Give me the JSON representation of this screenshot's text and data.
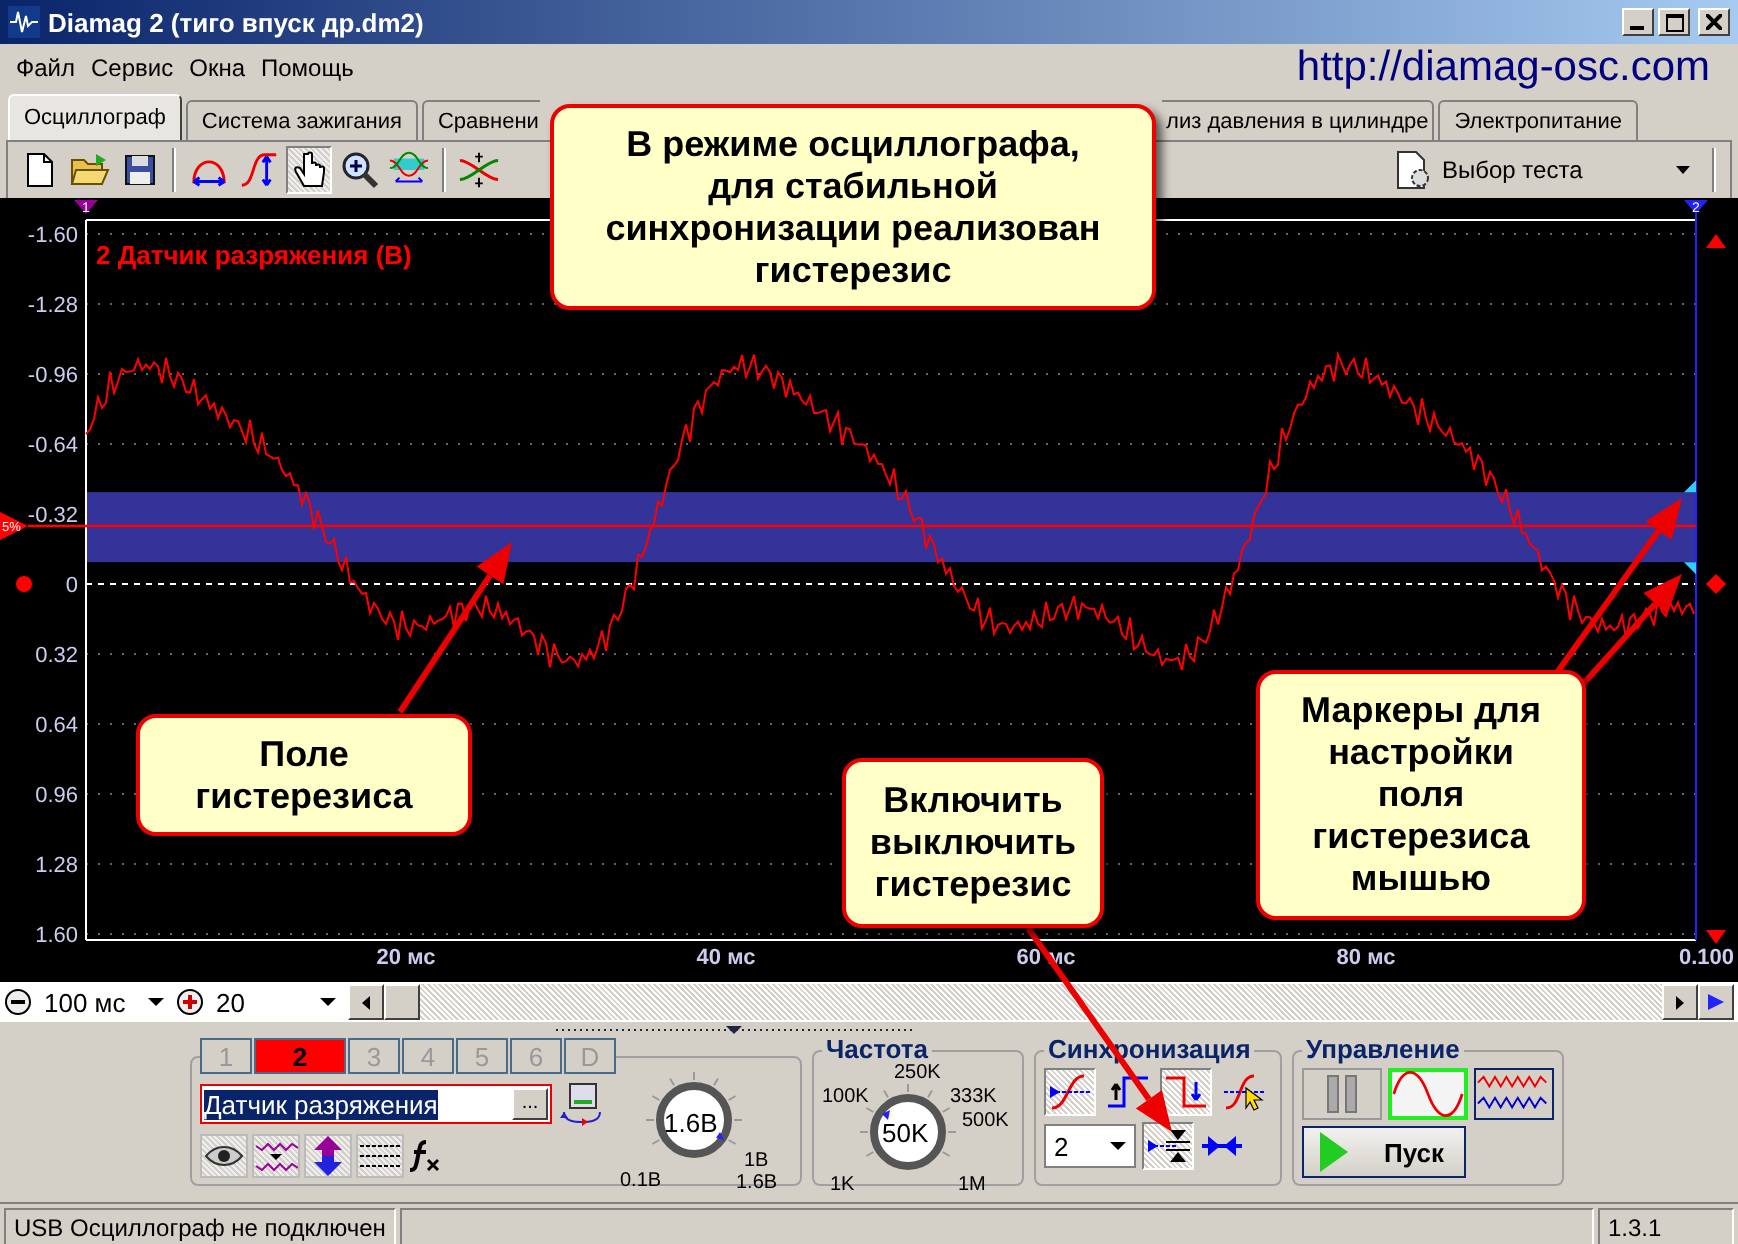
{
  "window": {
    "title": "Diamag 2 (тиго впуск др.dm2)"
  },
  "menu": [
    "Файл",
    "Сервис",
    "Окна",
    "Помощь"
  ],
  "site_url": "http://diamag-osc.com",
  "tabs": [
    {
      "label": "Осциллограф",
      "selected": true
    },
    {
      "label": "Система зажигания",
      "selected": false
    },
    {
      "label": "Сравнени",
      "selected": false
    },
    {
      "label": "лиз давления в цилиндре",
      "selected": false
    },
    {
      "label": "Электропитание",
      "selected": false
    }
  ],
  "toolbar": {
    "tool_groups": [
      [
        {
          "kind": "new",
          "pressed": false
        },
        {
          "kind": "open",
          "pressed": false
        },
        {
          "kind": "save",
          "pressed": false
        }
      ],
      [
        {
          "kind": "span",
          "pressed": false
        },
        {
          "kind": "rise",
          "pressed": false
        },
        {
          "kind": "hand",
          "pressed": true
        },
        {
          "kind": "zoom",
          "pressed": false
        },
        {
          "kind": "envelope",
          "pressed": false
        }
      ],
      [
        {
          "kind": "crossing",
          "pressed": false
        }
      ]
    ],
    "test_select": "Выбор теста"
  },
  "scope": {
    "channel_label": "2 Датчик разряжения (В)",
    "y_labels": [
      "-1.60",
      "-1.28",
      "-0.96",
      "-0.64",
      "-0.32",
      "0",
      "0.32",
      "0.64",
      "0.96",
      "1.28",
      "1.60"
    ],
    "x_labels": [
      "20 мс",
      "40 мс",
      "60 мс",
      "80 мс",
      "0.100"
    ],
    "cursor_labels": [
      "1",
      "2"
    ],
    "trigger_label": "5%"
  },
  "timebase": {
    "scale": "100 мс",
    "zoom": "20"
  },
  "channel_panel": {
    "channels": [
      {
        "label": "1",
        "selected": false
      },
      {
        "label": "2",
        "selected": true
      },
      {
        "label": "3",
        "selected": false
      },
      {
        "label": "4",
        "selected": false
      },
      {
        "label": "5",
        "selected": false
      },
      {
        "label": "6",
        "selected": false
      },
      {
        "label": "D",
        "selected": false
      }
    ],
    "name_field": "Датчик разряжения",
    "browse_button": "...",
    "tools": [
      {
        "kind": "eye"
      },
      {
        "kind": "wave"
      },
      {
        "kind": "arrows"
      },
      {
        "kind": "lines"
      },
      {
        "kind": "fx"
      }
    ],
    "knob": {
      "value": "1.6В",
      "labels": [
        "0.1В",
        "1В",
        "1.6В"
      ]
    }
  },
  "frequency": {
    "title": "Частота",
    "knob": {
      "value": "50K",
      "labels": [
        "100K",
        "250K",
        "333K",
        "500K",
        "1K",
        "1M"
      ]
    }
  },
  "sync": {
    "title": "Синхронизация",
    "buttons": [
      {
        "kind": "rise-curve",
        "pressed": true
      },
      {
        "kind": "step-up",
        "pressed": false
      },
      {
        "kind": "step-down",
        "pressed": true
      },
      {
        "kind": "cursor-curve",
        "pressed": false
      }
    ],
    "channel": "2",
    "hysteresis_pressed": true
  },
  "control": {
    "title": "Управление",
    "modes": [
      {
        "kind": "pause",
        "selected": false
      },
      {
        "kind": "sine",
        "selected": true
      },
      {
        "kind": "multi",
        "selected": false
      }
    ],
    "start_button": "Пуск"
  },
  "status_bar": {
    "message": "USB Осциллограф не подключен",
    "version": "1.3.1"
  },
  "callouts": [
    {
      "text": "В режиме осциллографа,\nдля стабильной\nсинхронизации реализован\nгистерезис"
    },
    {
      "text": "Поле\nгистерезиса"
    },
    {
      "text": "Включить\nвыключить\nгистерезис"
    },
    {
      "text": "Маркеры для\nнастройки\nполя\nгистерезиса\nмышью"
    }
  ]
}
